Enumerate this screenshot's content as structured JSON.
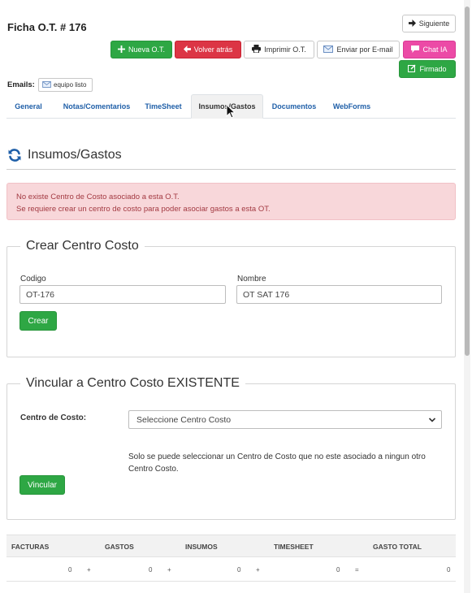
{
  "header": {
    "title": "Ficha O.T. # 176",
    "next_label": "Siguiente"
  },
  "toolbar": {
    "nueva_label": "Nueva O.T.",
    "volver_label": "Volver atrás",
    "imprimir_label": "Imprimir O.T.",
    "email_label": "Enviar por E-mail",
    "chat_label": "Chat IA",
    "firmado_label": "Firmado"
  },
  "emails": {
    "label": "Emails:",
    "chip_label": "equipo listo"
  },
  "tabs": [
    {
      "label": "General"
    },
    {
      "label": "Notas/Comentarios"
    },
    {
      "label": "TimeSheet"
    },
    {
      "label": "Insumos/Gastos"
    },
    {
      "label": "Documentos"
    },
    {
      "label": "WebForms"
    }
  ],
  "section": {
    "title": "Insumos/Gastos"
  },
  "alert": {
    "line1": "No existe Centro de Costo asociado a esta O.T.",
    "line2": "Se requiere crear un centro de costo para poder asociar gastos a esta OT."
  },
  "crear_centro": {
    "legend": "Crear Centro Costo",
    "codigo_label": "Codigo",
    "codigo_value": "OT-176",
    "nombre_label": "Nombre",
    "nombre_value": "OT SAT 176",
    "crear_button": "Crear"
  },
  "vincular": {
    "legend": "Vincular a Centro Costo EXISTENTE",
    "centro_label": "Centro de Costo:",
    "select_value": "Seleccione Centro Costo",
    "help_line1": "Solo se puede seleccionar un Centro de Costo que no este asociado a ningun otro",
    "help_line2": "Centro Costo.",
    "vincular_button": "Vincular"
  },
  "totals": {
    "headers": [
      "FACTURAS",
      "GASTOS",
      "INSUMOS",
      "TIMESHEET",
      "GASTO TOTAL"
    ],
    "values": [
      "0",
      "0",
      "0",
      "0",
      "0"
    ],
    "operators": [
      "+",
      "+",
      "+",
      "="
    ]
  },
  "colors": {
    "green": "#2ea744",
    "red": "#dc3545",
    "pink": "#ec4aa6",
    "link_blue": "#1f5fa8",
    "alert_bg": "#f8d7da",
    "alert_text": "#a33a42"
  }
}
